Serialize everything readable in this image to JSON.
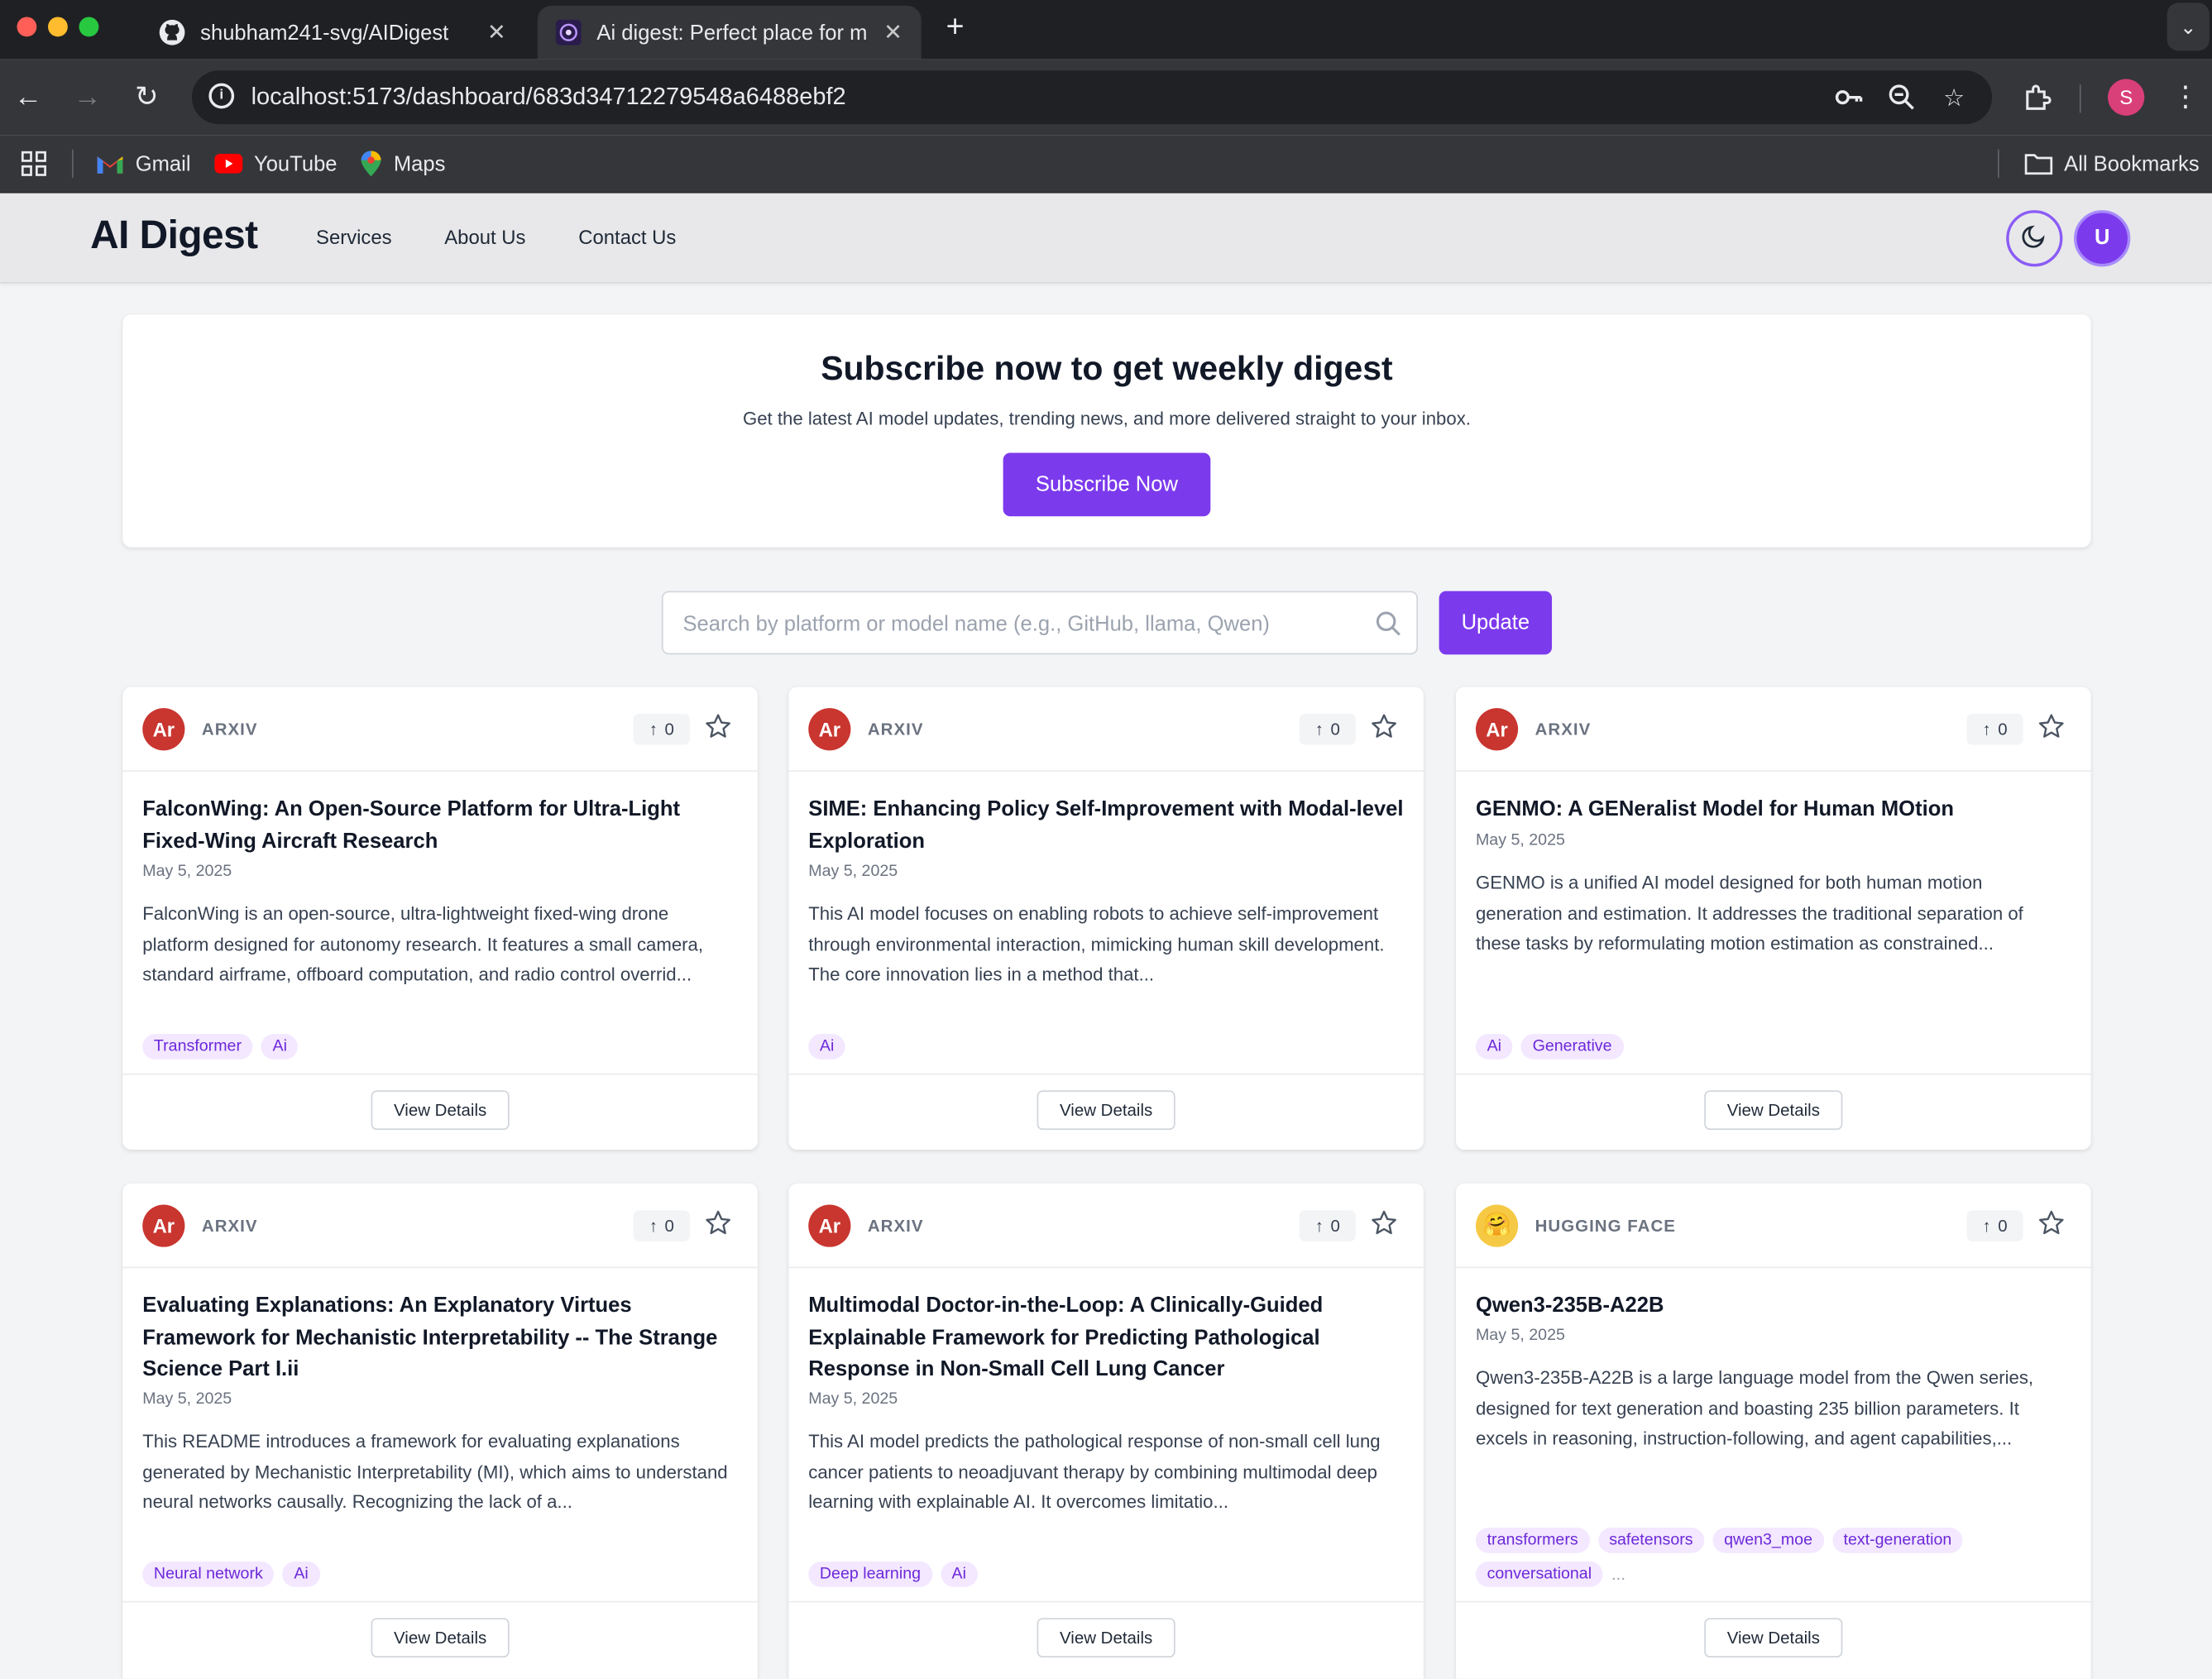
{
  "browser": {
    "tabs": [
      {
        "title": "shubham241-svg/AIDigest",
        "favicon": "github-icon",
        "active": false
      },
      {
        "title": "Ai digest: Perfect place for m",
        "favicon": "app-favicon",
        "active": true
      }
    ],
    "url": "localhost:5173/dashboard/683d34712279548a6488ebf2",
    "profile_initial": "S",
    "bookmarks": [
      {
        "label": "Gmail",
        "icon": "gmail-icon"
      },
      {
        "label": "YouTube",
        "icon": "youtube-icon"
      },
      {
        "label": "Maps",
        "icon": "maps-icon"
      }
    ],
    "all_bookmarks": "All Bookmarks"
  },
  "header": {
    "brand": "AI Digest",
    "nav": [
      "Services",
      "About Us",
      "Contact Us"
    ],
    "avatar_initial": "U"
  },
  "subscribe": {
    "title": "Subscribe now to get weekly digest",
    "subtitle": "Get the latest AI model updates, trending news, and more delivered straight to your inbox.",
    "button": "Subscribe Now"
  },
  "search": {
    "placeholder": "Search by platform or model name (e.g., GitHub, llama, Qwen)",
    "value": "",
    "button": "Update"
  },
  "colors": {
    "accent": "#7c3aed",
    "arxiv_logo": "#c9352f",
    "hf_logo": "#f6c945",
    "tag_bg": "#f3e8ff",
    "tag_text": "#6d28d9"
  },
  "cards": [
    {
      "logo": "Ar",
      "source": "ARXIV",
      "votes": "0",
      "title": "FalconWing: An Open-Source Platform for Ultra-Light Fixed-Wing Aircraft Research",
      "date": "May 5, 2025",
      "description": "FalconWing is an open-source, ultra-lightweight fixed-wing drone platform designed for autonomy research. It features a small camera, standard airframe, offboard computation, and radio control overrid...",
      "tags": [
        "Transformer",
        "Ai"
      ],
      "more": "",
      "button": "View Details"
    },
    {
      "logo": "Ar",
      "source": "ARXIV",
      "votes": "0",
      "title": "SIME: Enhancing Policy Self-Improvement with Modal-level Exploration",
      "date": "May 5, 2025",
      "description": "This AI model focuses on enabling robots to achieve self-improvement through environmental interaction, mimicking human skill development. The core innovation lies in a method that...",
      "tags": [
        "Ai"
      ],
      "more": "",
      "button": "View Details"
    },
    {
      "logo": "Ar",
      "source": "ARXIV",
      "votes": "0",
      "title": "GENMO: A GENeralist Model for Human MOtion",
      "date": "May 5, 2025",
      "description": "GENMO is a unified AI model designed for both human motion generation and estimation. It addresses the traditional separation of these tasks by reformulating motion estimation as constrained...",
      "tags": [
        "Ai",
        "Generative"
      ],
      "more": "",
      "button": "View Details"
    },
    {
      "logo": "Ar",
      "source": "ARXIV",
      "votes": "0",
      "title": "Evaluating Explanations: An Explanatory Virtues Framework for Mechanistic Interpretability -- The Strange Science Part I.ii",
      "date": "May 5, 2025",
      "description": "This README introduces a framework for evaluating explanations generated by Mechanistic Interpretability (MI), which aims to understand neural networks causally. Recognizing the lack of a...",
      "tags": [
        "Neural network",
        "Ai"
      ],
      "more": "",
      "button": "View Details"
    },
    {
      "logo": "Ar",
      "source": "ARXIV",
      "votes": "0",
      "title": "Multimodal Doctor-in-the-Loop: A Clinically-Guided Explainable Framework for Predicting Pathological Response in Non-Small Cell Lung Cancer",
      "date": "May 5, 2025",
      "description": "This AI model predicts the pathological response of non-small cell lung cancer patients to neoadjuvant therapy by combining multimodal deep learning with explainable AI. It overcomes limitatio...",
      "tags": [
        "Deep learning",
        "Ai"
      ],
      "more": "",
      "button": "View Details"
    },
    {
      "logo": "🤗",
      "source": "HUGGING FACE",
      "votes": "0",
      "title": "Qwen3-235B-A22B",
      "date": "May 5, 2025",
      "description": "Qwen3-235B-A22B is a large language model from the Qwen series, designed for text generation and boasting 235 billion parameters. It excels in reasoning, instruction-following, and agent capabilities,...",
      "tags": [
        "transformers",
        "safetensors",
        "qwen3_moe",
        "text-generation",
        "conversational"
      ],
      "more": "...",
      "button": "View Details"
    }
  ]
}
